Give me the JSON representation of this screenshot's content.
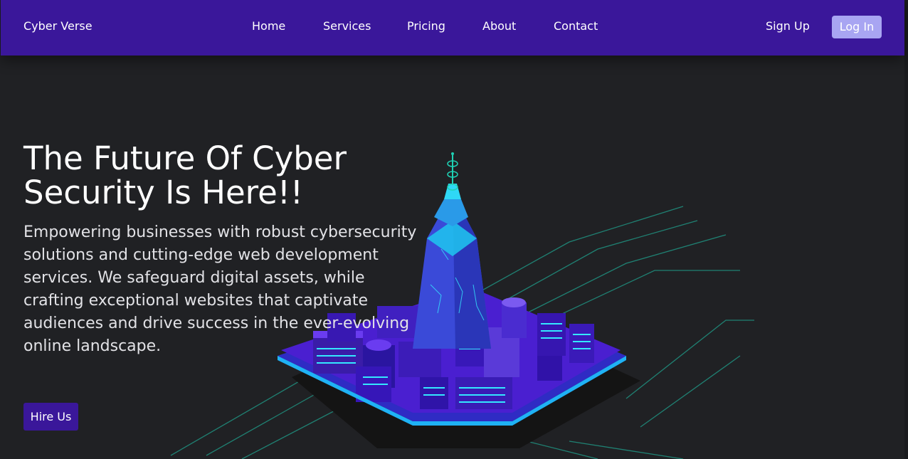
{
  "navbar": {
    "brand": "Cyber Verse",
    "links": [
      "Home",
      "Services",
      "Pricing",
      "About",
      "Contact"
    ],
    "signup_label": "Sign Up",
    "login_label": "Log In"
  },
  "hero": {
    "title": "The Future Of Cyber Security Is Here!!",
    "description": "Empowering businesses with robust cybersecurity solutions and cutting-edge web development services. We safeguard digital assets, while crafting exceptional websites that captivate audiences and drive success in the ever-evolving online landscape.",
    "cta_label": "Hire Us"
  },
  "colors": {
    "nav_bg": "#3a179a",
    "page_bg": "#202124",
    "login_bg": "#a8a5f2",
    "circuit": "#1fd1b4",
    "building": "#3f1fc9"
  }
}
